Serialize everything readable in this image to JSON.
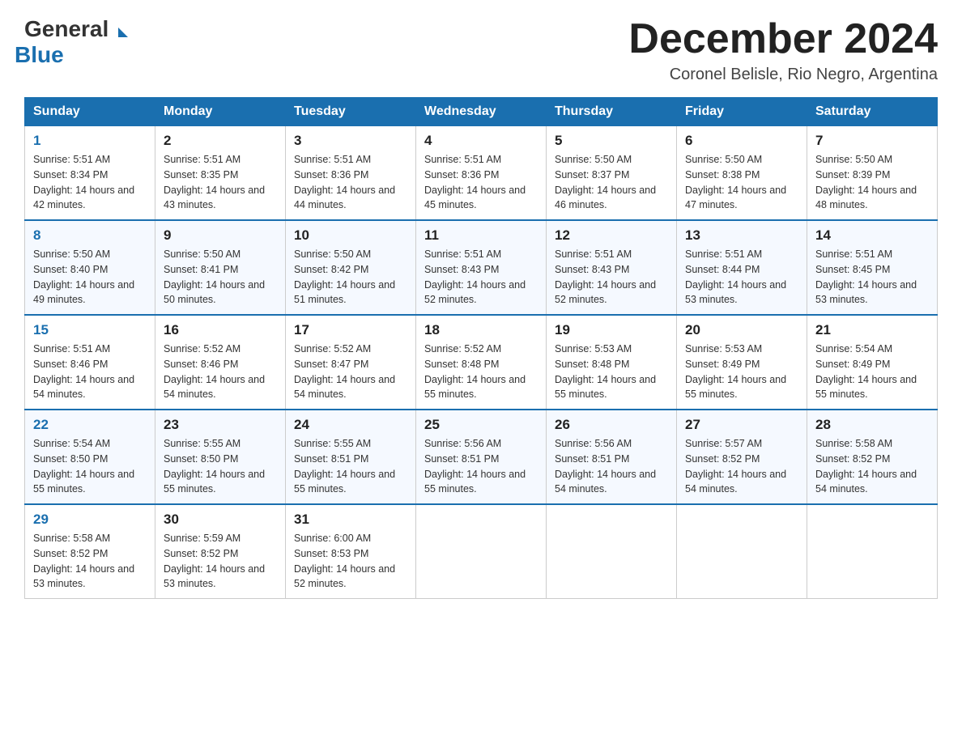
{
  "header": {
    "logo_general": "General",
    "logo_blue": "Blue",
    "main_title": "December 2024",
    "subtitle": "Coronel Belisle, Rio Negro, Argentina"
  },
  "days_of_week": [
    "Sunday",
    "Monday",
    "Tuesday",
    "Wednesday",
    "Thursday",
    "Friday",
    "Saturday"
  ],
  "weeks": [
    [
      {
        "day": 1,
        "sunrise": "5:51 AM",
        "sunset": "8:34 PM",
        "daylight": "14 hours and 42 minutes."
      },
      {
        "day": 2,
        "sunrise": "5:51 AM",
        "sunset": "8:35 PM",
        "daylight": "14 hours and 43 minutes."
      },
      {
        "day": 3,
        "sunrise": "5:51 AM",
        "sunset": "8:36 PM",
        "daylight": "14 hours and 44 minutes."
      },
      {
        "day": 4,
        "sunrise": "5:51 AM",
        "sunset": "8:36 PM",
        "daylight": "14 hours and 45 minutes."
      },
      {
        "day": 5,
        "sunrise": "5:50 AM",
        "sunset": "8:37 PM",
        "daylight": "14 hours and 46 minutes."
      },
      {
        "day": 6,
        "sunrise": "5:50 AM",
        "sunset": "8:38 PM",
        "daylight": "14 hours and 47 minutes."
      },
      {
        "day": 7,
        "sunrise": "5:50 AM",
        "sunset": "8:39 PM",
        "daylight": "14 hours and 48 minutes."
      }
    ],
    [
      {
        "day": 8,
        "sunrise": "5:50 AM",
        "sunset": "8:40 PM",
        "daylight": "14 hours and 49 minutes."
      },
      {
        "day": 9,
        "sunrise": "5:50 AM",
        "sunset": "8:41 PM",
        "daylight": "14 hours and 50 minutes."
      },
      {
        "day": 10,
        "sunrise": "5:50 AM",
        "sunset": "8:42 PM",
        "daylight": "14 hours and 51 minutes."
      },
      {
        "day": 11,
        "sunrise": "5:51 AM",
        "sunset": "8:43 PM",
        "daylight": "14 hours and 52 minutes."
      },
      {
        "day": 12,
        "sunrise": "5:51 AM",
        "sunset": "8:43 PM",
        "daylight": "14 hours and 52 minutes."
      },
      {
        "day": 13,
        "sunrise": "5:51 AM",
        "sunset": "8:44 PM",
        "daylight": "14 hours and 53 minutes."
      },
      {
        "day": 14,
        "sunrise": "5:51 AM",
        "sunset": "8:45 PM",
        "daylight": "14 hours and 53 minutes."
      }
    ],
    [
      {
        "day": 15,
        "sunrise": "5:51 AM",
        "sunset": "8:46 PM",
        "daylight": "14 hours and 54 minutes."
      },
      {
        "day": 16,
        "sunrise": "5:52 AM",
        "sunset": "8:46 PM",
        "daylight": "14 hours and 54 minutes."
      },
      {
        "day": 17,
        "sunrise": "5:52 AM",
        "sunset": "8:47 PM",
        "daylight": "14 hours and 54 minutes."
      },
      {
        "day": 18,
        "sunrise": "5:52 AM",
        "sunset": "8:48 PM",
        "daylight": "14 hours and 55 minutes."
      },
      {
        "day": 19,
        "sunrise": "5:53 AM",
        "sunset": "8:48 PM",
        "daylight": "14 hours and 55 minutes."
      },
      {
        "day": 20,
        "sunrise": "5:53 AM",
        "sunset": "8:49 PM",
        "daylight": "14 hours and 55 minutes."
      },
      {
        "day": 21,
        "sunrise": "5:54 AM",
        "sunset": "8:49 PM",
        "daylight": "14 hours and 55 minutes."
      }
    ],
    [
      {
        "day": 22,
        "sunrise": "5:54 AM",
        "sunset": "8:50 PM",
        "daylight": "14 hours and 55 minutes."
      },
      {
        "day": 23,
        "sunrise": "5:55 AM",
        "sunset": "8:50 PM",
        "daylight": "14 hours and 55 minutes."
      },
      {
        "day": 24,
        "sunrise": "5:55 AM",
        "sunset": "8:51 PM",
        "daylight": "14 hours and 55 minutes."
      },
      {
        "day": 25,
        "sunrise": "5:56 AM",
        "sunset": "8:51 PM",
        "daylight": "14 hours and 55 minutes."
      },
      {
        "day": 26,
        "sunrise": "5:56 AM",
        "sunset": "8:51 PM",
        "daylight": "14 hours and 54 minutes."
      },
      {
        "day": 27,
        "sunrise": "5:57 AM",
        "sunset": "8:52 PM",
        "daylight": "14 hours and 54 minutes."
      },
      {
        "day": 28,
        "sunrise": "5:58 AM",
        "sunset": "8:52 PM",
        "daylight": "14 hours and 54 minutes."
      }
    ],
    [
      {
        "day": 29,
        "sunrise": "5:58 AM",
        "sunset": "8:52 PM",
        "daylight": "14 hours and 53 minutes."
      },
      {
        "day": 30,
        "sunrise": "5:59 AM",
        "sunset": "8:52 PM",
        "daylight": "14 hours and 53 minutes."
      },
      {
        "day": 31,
        "sunrise": "6:00 AM",
        "sunset": "8:53 PM",
        "daylight": "14 hours and 52 minutes."
      },
      null,
      null,
      null,
      null
    ]
  ]
}
